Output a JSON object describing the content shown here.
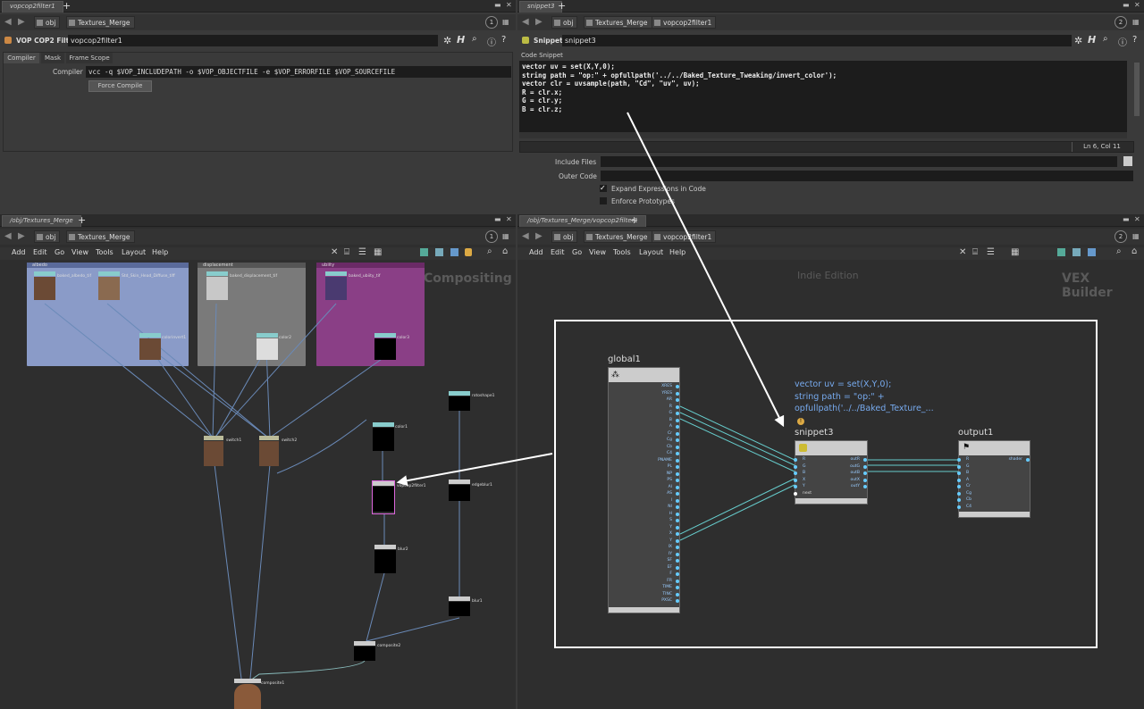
{
  "top_left": {
    "tab": "vopcop2filter1",
    "path": {
      "crumb1": "obj",
      "crumb2": "Textures_Merge"
    },
    "pin_badge": "1",
    "op_type": "VOP COP2 Filter",
    "op_name": "vopcop2filter1",
    "tabs": [
      "Compiler",
      "Mask",
      "Frame Scope"
    ],
    "compiler_label": "Compiler",
    "compiler_value": "vcc -q $VOP_INCLUDEPATH -o $VOP_OBJECTFILE -e $VOP_ERRORFILE $VOP_SOURCEFILE",
    "force_compile": "Force Compile"
  },
  "top_right": {
    "tab": "snippet3",
    "path": {
      "crumb1": "obj",
      "crumb2": "Textures_Merge",
      "crumb3": "vopcop2filter1"
    },
    "pin_badge": "2",
    "op_type": "Snippet",
    "op_name": "snippet3",
    "code_label": "Code Snippet",
    "code": [
      "vector uv  = set(X,Y,0);",
      "string path = \"op:\" + opfullpath('../../Baked_Texture_Tweaking/invert_color');",
      "vector clr = uvsample(path, \"Cd\", \"uv\", uv);",
      "R = clr.x;",
      "G = clr.y;",
      "B = clr.z;"
    ],
    "status": "Ln 6, Col 11",
    "include_files": "Include Files",
    "outer_code": "Outer Code",
    "expand_expr": "Expand Expressions in Code",
    "enforce_proto": "Enforce Prototypes"
  },
  "bottom_left": {
    "tab": "/obj/Textures_Merge",
    "path": {
      "crumb1": "obj",
      "crumb2": "Textures_Merge"
    },
    "pin_badge": "1",
    "menu": [
      "Add",
      "Edit",
      "Go",
      "View",
      "Tools",
      "Layout",
      "Help"
    ],
    "context": "Compositing",
    "netboxes": {
      "albedo": "albedo",
      "displacement": "displacement",
      "ubiity": "ubiity"
    },
    "nodes": {
      "n1": "baked_albedo_tif",
      "n2": "Std_Skin_Head_Diffuse_tiff",
      "n3": "colorinvert1",
      "n4": "baked_displacement_tif",
      "n5": "color2",
      "n6": "baked_ubiity_tif",
      "n7": "color3",
      "n8": "switch1",
      "n9": "switch2",
      "n10": "color1",
      "n11": "rotoshape1",
      "n12": "vopcop2filter1",
      "n13": "edgeblur1",
      "n14": "blur2",
      "n15": "blur1",
      "n16": "composite2",
      "n17": "composite1"
    }
  },
  "bottom_right": {
    "tab": "/obj/Textures_Merge/vopcop2filter1",
    "path": {
      "crumb1": "obj",
      "crumb2": "Textures_Merge",
      "crumb3": "vopcop2filter1"
    },
    "pin_badge": "2",
    "menu": [
      "Add",
      "Edit",
      "Go",
      "View",
      "Tools",
      "Layout",
      "Help"
    ],
    "edition": "Indie Edition",
    "context": "VEX Builder",
    "global_node": "global1",
    "global_ports": [
      "XRES",
      "YRES",
      "AR",
      "R",
      "G",
      "B",
      "A",
      "Cr",
      "Cg",
      "Cb",
      "C4",
      "PNAME",
      "PL",
      "NP",
      "PS",
      "AI",
      "AS",
      "I",
      "NI",
      "H",
      "S",
      "Y",
      "X",
      "Y",
      "IX",
      "IY",
      "SF",
      "EF",
      "F",
      "FR",
      "TIME",
      "TINC",
      "PXSC"
    ],
    "snippet_node": "snippet3",
    "snippet_preview": [
      "vector uv  = set(X,Y,0);",
      "string path = \"op:\" +",
      "opfullpath('../../Baked_Texture_..."
    ],
    "snippet_in": [
      "R",
      "G",
      "B",
      "X",
      "Y",
      "next"
    ],
    "snippet_out": [
      "outR",
      "outG",
      "outB",
      "outX",
      "outY"
    ],
    "output_node": "output1",
    "output_in": [
      "R",
      "G",
      "B",
      "A",
      "Cr",
      "Cg",
      "Cb",
      "C4"
    ],
    "output_out": "shader"
  },
  "colors": {
    "accent": "#6cf",
    "albedo": "#8a9bc8",
    "displacement": "#7a7a7a",
    "ubiity": "#8a3f86",
    "highlight": "#ffffff"
  }
}
